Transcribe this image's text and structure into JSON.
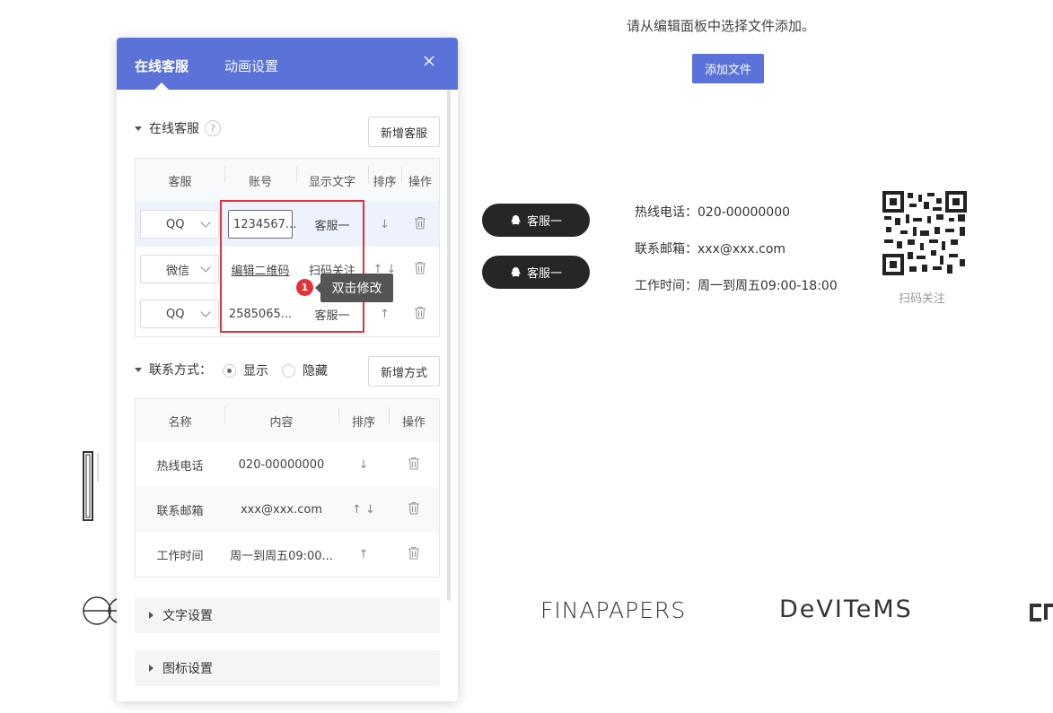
{
  "canvas": {
    "hint": "请从编辑面板中选择文件添加。",
    "add_file_button": "添加文件",
    "preview": {
      "buttons": [
        {
          "label": "客服一"
        },
        {
          "label": "客服一"
        }
      ],
      "contacts": [
        {
          "text": "热线电话：020-00000000"
        },
        {
          "text": "联系邮箱：xxx@xxx.com"
        },
        {
          "text": "工作时间：周一到周五09:00-18:00"
        }
      ],
      "qr_label": "扫码关注"
    },
    "logos": [
      "FINAPAPERS",
      "DeVITeMS"
    ]
  },
  "panel": {
    "tabs": [
      {
        "label": "在线客服"
      },
      {
        "label": "动画设置"
      }
    ],
    "service": {
      "title": "在线客服",
      "help": "?",
      "add_button": "新增客服",
      "headers": [
        "客服",
        "账号",
        "显示文字",
        "排序",
        "操作"
      ],
      "rows": [
        {
          "type": "QQ",
          "account": "1234567...",
          "text": "客服一",
          "sort": "↓"
        },
        {
          "type": "微信",
          "account": "编辑二维码",
          "text": "扫码关注",
          "sort": "↑ ↓"
        },
        {
          "type": "QQ",
          "account": "2585065...",
          "text": "客服一",
          "sort": "↑"
        }
      ]
    },
    "tooltip": {
      "badge": "1",
      "text": "双击修改"
    },
    "contact": {
      "title": "联系方式：",
      "show_label": "显示",
      "hide_label": "隐藏",
      "selected": "显示",
      "add_button": "新增方式",
      "headers": [
        "名称",
        "内容",
        "排序",
        "操作"
      ],
      "rows": [
        {
          "name": "热线电话",
          "content": "020-00000000",
          "sort": "↓"
        },
        {
          "name": "联系邮箱",
          "content": "xxx@xxx.com",
          "sort": "↑ ↓"
        },
        {
          "name": "工作时间",
          "content": "周一到周五09:00...",
          "sort": "↑"
        }
      ]
    },
    "sections": [
      {
        "label": "文字设置"
      },
      {
        "label": "图标设置"
      }
    ]
  },
  "colors": {
    "accent": "#5b73d9",
    "highlight": "#e0333a",
    "pill": "#262626"
  }
}
